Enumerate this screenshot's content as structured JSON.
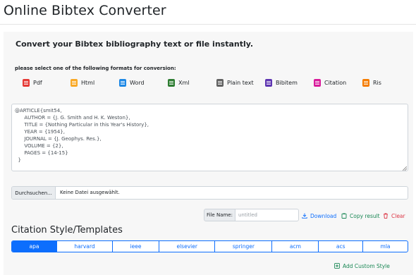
{
  "header": {
    "title": "Online Bibtex Converter"
  },
  "intro": {
    "tagline": "Convert your Bibtex bibliography text or file instantly.",
    "select_hint": "please select one of the following formats for conversion:"
  },
  "formats": [
    {
      "label": "Pdf",
      "color": "#e53935",
      "icon": "pdf-file-icon"
    },
    {
      "label": "Html",
      "color": "#f9a825",
      "icon": "html-file-icon"
    },
    {
      "label": "Word",
      "color": "#1e88e5",
      "icon": "word-file-icon"
    },
    {
      "label": "Xml",
      "color": "#2e7d32",
      "icon": "xml-file-icon"
    },
    {
      "label": "Plain text",
      "color": "#616161",
      "icon": "text-file-icon"
    },
    {
      "label": "Bibitem",
      "color": "#5e35b1",
      "icon": "bibitem-file-icon"
    },
    {
      "label": "Citation",
      "color": "#d81b9b",
      "icon": "citation-file-icon"
    },
    {
      "label": "Ris",
      "color": "#f57c00",
      "icon": "ris-file-icon"
    }
  ],
  "editor": {
    "content": "@ARTICLE{smit54,\n      AUTHOR = {J. G. Smith and H. K. Weston},\n      TITLE = {Nothing Particular in this Year's History},\n      YEAR = {1954},\n      JOURNAL = {J. Geophys. Res.},\n      VOLUME = {2},\n      PAGES = {14-15}\n  }"
  },
  "file_picker": {
    "browse_label": "Durchsuchen...",
    "status": "Keine Datei ausgewählt."
  },
  "file_name": {
    "label": "File Name:",
    "placeholder": "untitled",
    "value": ""
  },
  "actions": {
    "download": "Download",
    "copy": "Copy result",
    "clear": "Clear"
  },
  "citation_styles": {
    "title": "Citation Style/Templates",
    "selected": "apa",
    "tabs": [
      "apa",
      "harvard",
      "ieee",
      "elsevier",
      "springer",
      "acm",
      "acs",
      "mla"
    ],
    "add_custom": "Add Custom Style"
  },
  "colors": {
    "primary": "#0d6efd",
    "success": "#198754",
    "danger": "#dc3545"
  }
}
